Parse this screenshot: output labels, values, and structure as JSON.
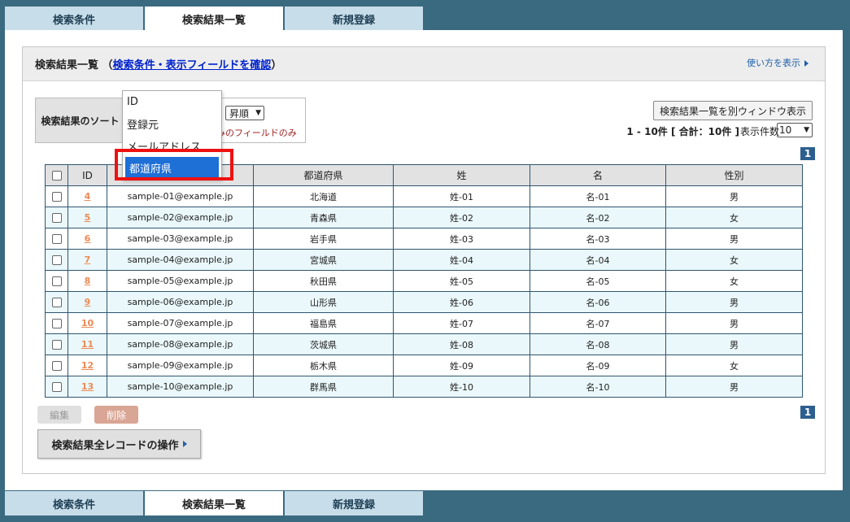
{
  "tabs": [
    {
      "label": "検索条件"
    },
    {
      "label": "検索結果一覧"
    },
    {
      "label": "新規登録"
    }
  ],
  "panel": {
    "title": "検索結果一覧",
    "open_paren": "（",
    "title_link": "検索条件・表示フィールドを確認",
    "close_paren": "）",
    "help": "使い方を表示"
  },
  "sort": {
    "label": "検索結果のソート",
    "field_value": "ID",
    "order_value": "昇順",
    "note": "みのフィールドのみ"
  },
  "dropdown": {
    "options": [
      "ID",
      "登録元",
      "メールアドレス",
      "都道府県"
    ],
    "selected": "都道府県"
  },
  "toolbar": {
    "window_button": "検索結果一覧を別ウィンドウ表示",
    "result_info": "1 - 10件 [ 合計：10件 ]",
    "per_page_label": "表示件数",
    "per_page_value": "10",
    "page": "1"
  },
  "table": {
    "headers": [
      "ID",
      "メールアドレス",
      "都道府県",
      "姓",
      "名",
      "性別"
    ],
    "rows": [
      {
        "id": "4",
        "email": "sample-01@example.jp",
        "pref": "北海道",
        "sei": "姓-01",
        "mei": "名-01",
        "gender": "男"
      },
      {
        "id": "5",
        "email": "sample-02@example.jp",
        "pref": "青森県",
        "sei": "姓-02",
        "mei": "名-02",
        "gender": "女"
      },
      {
        "id": "6",
        "email": "sample-03@example.jp",
        "pref": "岩手県",
        "sei": "姓-03",
        "mei": "名-03",
        "gender": "男"
      },
      {
        "id": "7",
        "email": "sample-04@example.jp",
        "pref": "宮城県",
        "sei": "姓-04",
        "mei": "名-04",
        "gender": "女"
      },
      {
        "id": "8",
        "email": "sample-05@example.jp",
        "pref": "秋田県",
        "sei": "姓-05",
        "mei": "名-05",
        "gender": "女"
      },
      {
        "id": "9",
        "email": "sample-06@example.jp",
        "pref": "山形県",
        "sei": "姓-06",
        "mei": "名-06",
        "gender": "男"
      },
      {
        "id": "10",
        "email": "sample-07@example.jp",
        "pref": "福島県",
        "sei": "姓-07",
        "mei": "名-07",
        "gender": "男"
      },
      {
        "id": "11",
        "email": "sample-08@example.jp",
        "pref": "茨城県",
        "sei": "姓-08",
        "mei": "名-08",
        "gender": "男"
      },
      {
        "id": "12",
        "email": "sample-09@example.jp",
        "pref": "栃木県",
        "sei": "姓-09",
        "mei": "名-09",
        "gender": "女"
      },
      {
        "id": "13",
        "email": "sample-10@example.jp",
        "pref": "群馬県",
        "sei": "姓-10",
        "mei": "名-10",
        "gender": "男"
      }
    ]
  },
  "actions": {
    "edit": "編集",
    "delete": "削除",
    "all_records": "検索結果全レコードの操作"
  }
}
